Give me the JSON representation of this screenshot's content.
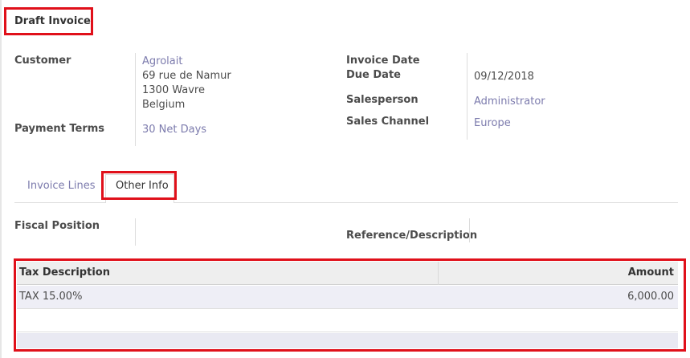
{
  "invoice": {
    "status_title": "Draft Invoice"
  },
  "customer": {
    "label": "Customer",
    "name": "Agrolait",
    "street": "69 rue de Namur",
    "city": "1300 Wavre",
    "country": "Belgium"
  },
  "payment_terms": {
    "label": "Payment Terms",
    "value": "30 Net Days"
  },
  "dates": {
    "invoice_date_label": "Invoice Date",
    "invoice_date_value": "",
    "due_date_label": "Due Date",
    "due_date_value": "09/12/2018"
  },
  "salesperson": {
    "label": "Salesperson",
    "value": "Administrator"
  },
  "sales_channel": {
    "label": "Sales Channel",
    "value": "Europe"
  },
  "tabs": [
    {
      "label": "Invoice Lines",
      "active": false
    },
    {
      "label": "Other Info",
      "active": true
    }
  ],
  "other_info": {
    "fiscal_position_label": "Fiscal Position",
    "fiscal_position_value": "",
    "reference_label": "Reference/Description",
    "reference_value": ""
  },
  "tax_table": {
    "columns": [
      "Tax Description",
      "Amount"
    ],
    "rows": [
      {
        "description": "TAX 15.00%",
        "amount": "6,000.00"
      }
    ]
  },
  "colors": {
    "link": "#7c7bad",
    "highlight": "#e0101a"
  }
}
